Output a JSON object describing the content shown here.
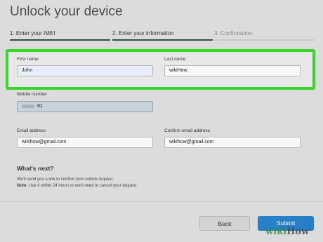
{
  "page": {
    "title": "Unlock your device"
  },
  "steps": [
    {
      "label": "1. Enter your IMEI",
      "state": "done"
    },
    {
      "label": "2. Enter your information",
      "state": "active"
    },
    {
      "label": "3. Confirmation",
      "state": "pending"
    }
  ],
  "colors": {
    "step_done": "#2f4f3f",
    "step_pending": "#c8c8c8",
    "highlight": "#3ad62e",
    "submit": "#2780c7"
  },
  "form": {
    "first_name": {
      "label": "First name",
      "value": "John"
    },
    "last_name": {
      "label": "Last name",
      "value": "wikiHow"
    },
    "mobile": {
      "label": "Mobile number",
      "value": "81"
    },
    "email": {
      "label": "Email address",
      "value": "wikihow@gmail.com"
    },
    "confirm_email": {
      "label": "Confirm email address",
      "value": "wikihow@gmail.com"
    }
  },
  "whats_next": {
    "heading": "What's next?",
    "line1": "We'll send you a link to confirm your unlock request.",
    "note_label": "Note:",
    "note_text": "Use it within 24 hours or we'll need to cancel your request."
  },
  "buttons": {
    "back": "Back",
    "submit": "Submit"
  },
  "watermark": {
    "prefix": "wiki",
    "suffix": "How"
  }
}
